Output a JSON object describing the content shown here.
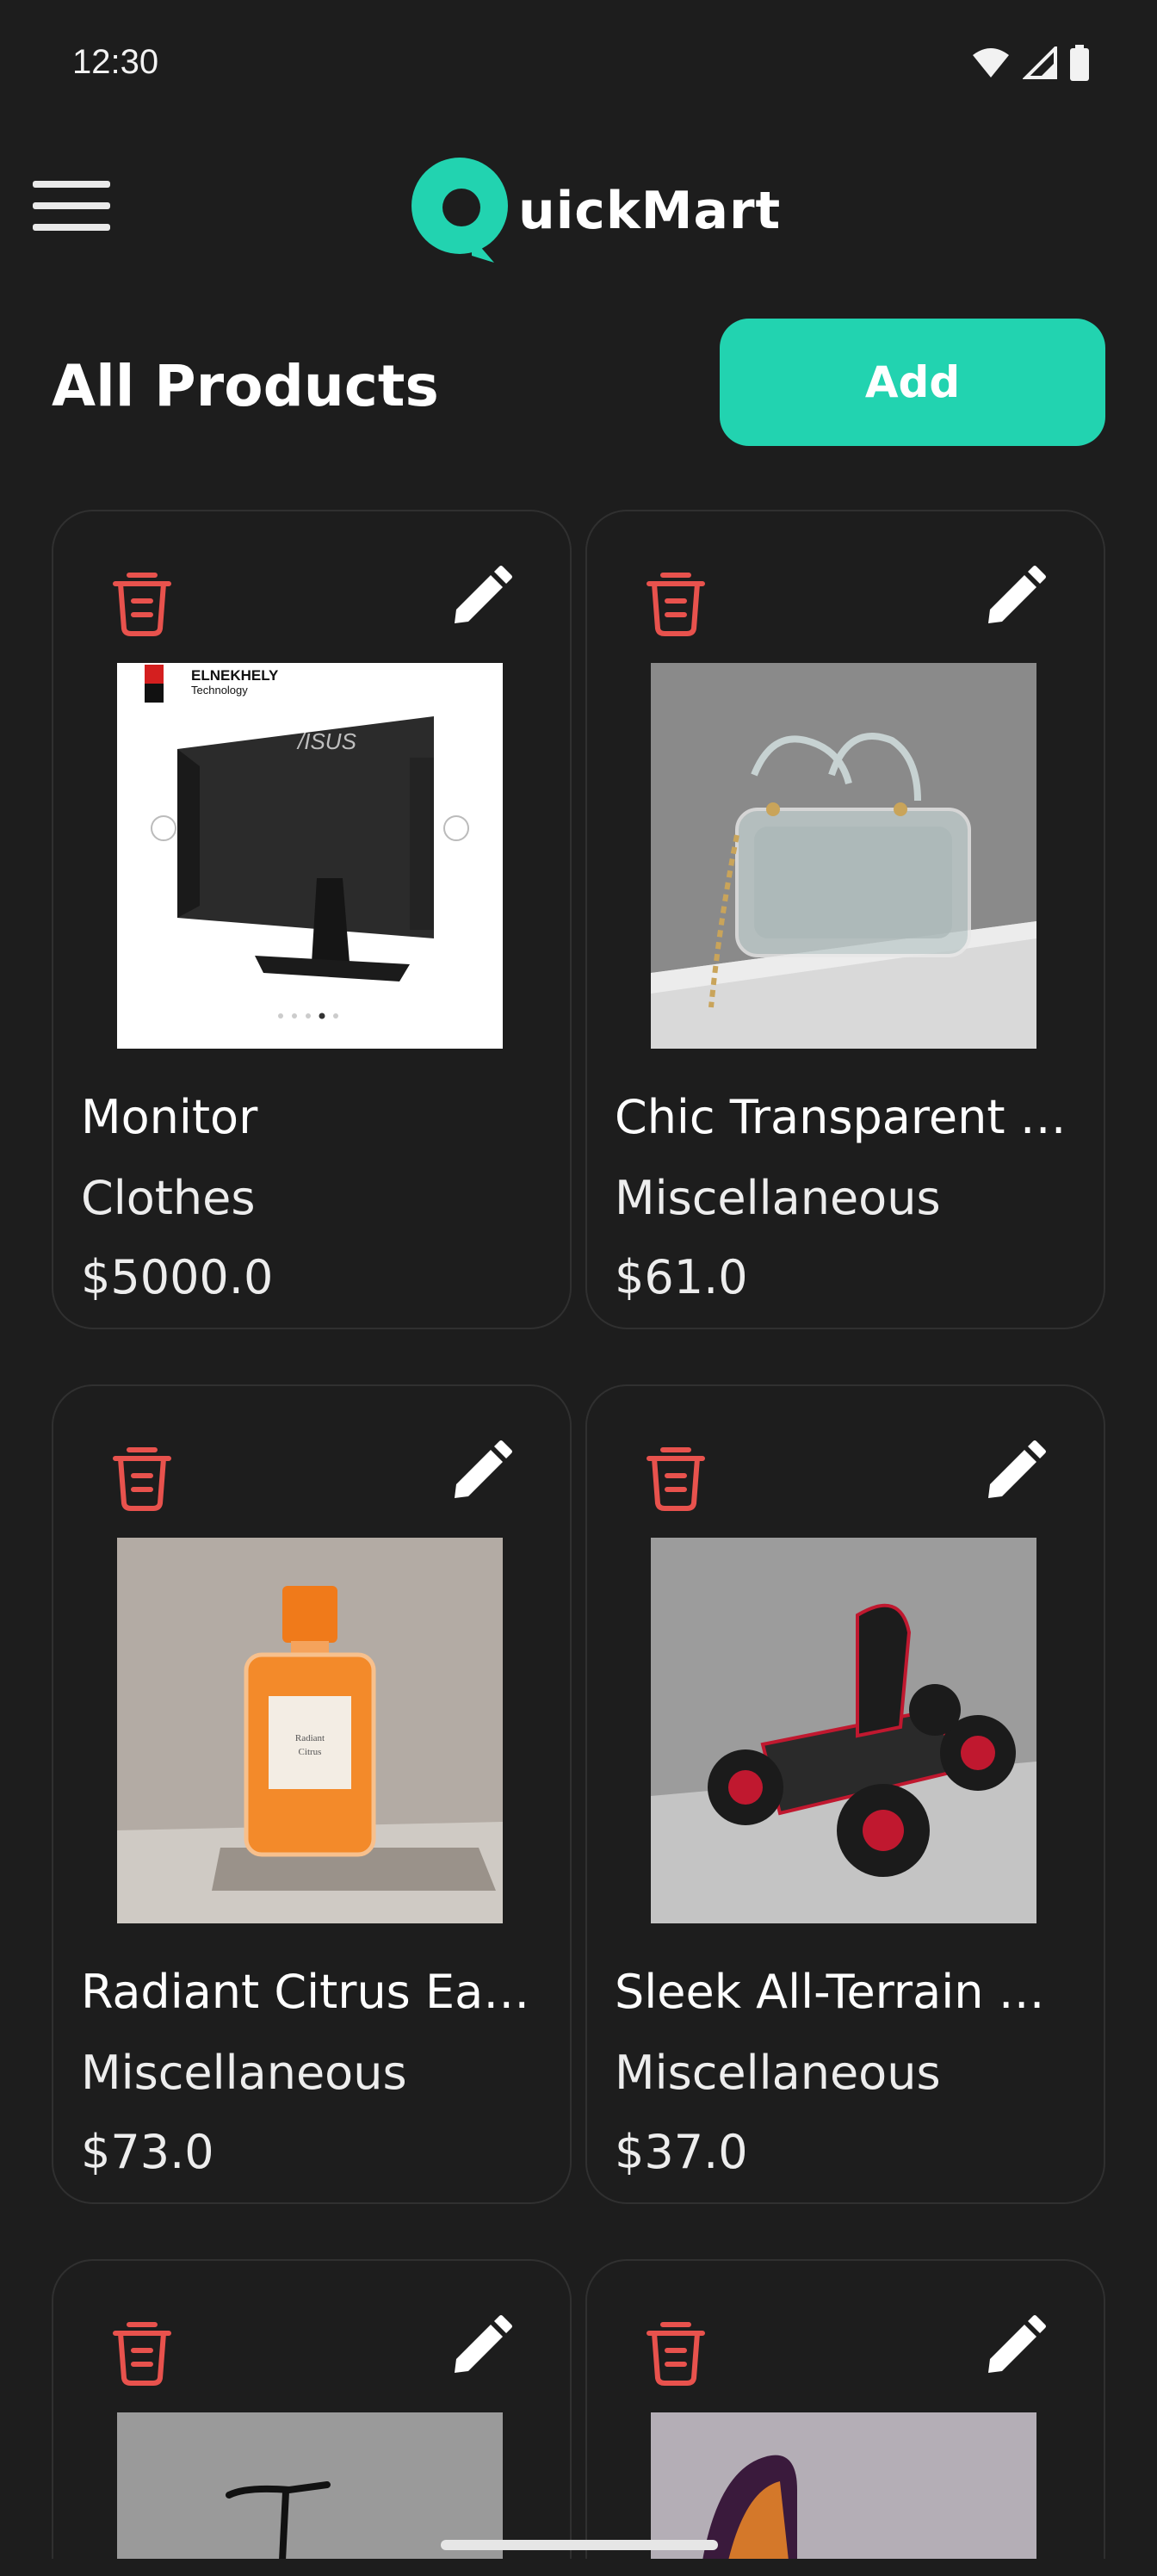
{
  "status_bar": {
    "time": "12:30"
  },
  "app": {
    "logo_text": "uickMart"
  },
  "header": {
    "title": "All Products",
    "add_label": "Add"
  },
  "products": [
    {
      "name": "Monitor",
      "category": "Clothes",
      "price": "$5000.0",
      "image": "asus-monitor-photo",
      "badge": "ELNEKHELY",
      "badge_sub": "Technology"
    },
    {
      "name": "Chic Transparent F…",
      "category": "Miscellaneous",
      "price": "$61.0",
      "image": "transparent-handbag-photo"
    },
    {
      "name": "Radiant Citrus Eau …",
      "category": "Miscellaneous",
      "price": "$73.0",
      "image": "orange-perfume-photo"
    },
    {
      "name": "Sleek All-Terrain G…",
      "category": "Miscellaneous",
      "price": "$37.0",
      "image": "go-kart-photo"
    },
    {
      "name": "",
      "category": "",
      "price": "",
      "image": "bicycle-photo"
    },
    {
      "name": "",
      "category": "",
      "price": "",
      "image": "shoe-photo"
    }
  ],
  "colors": {
    "accent": "#22d3b0",
    "delete": "#e8524d",
    "background": "#1d1d1d"
  }
}
